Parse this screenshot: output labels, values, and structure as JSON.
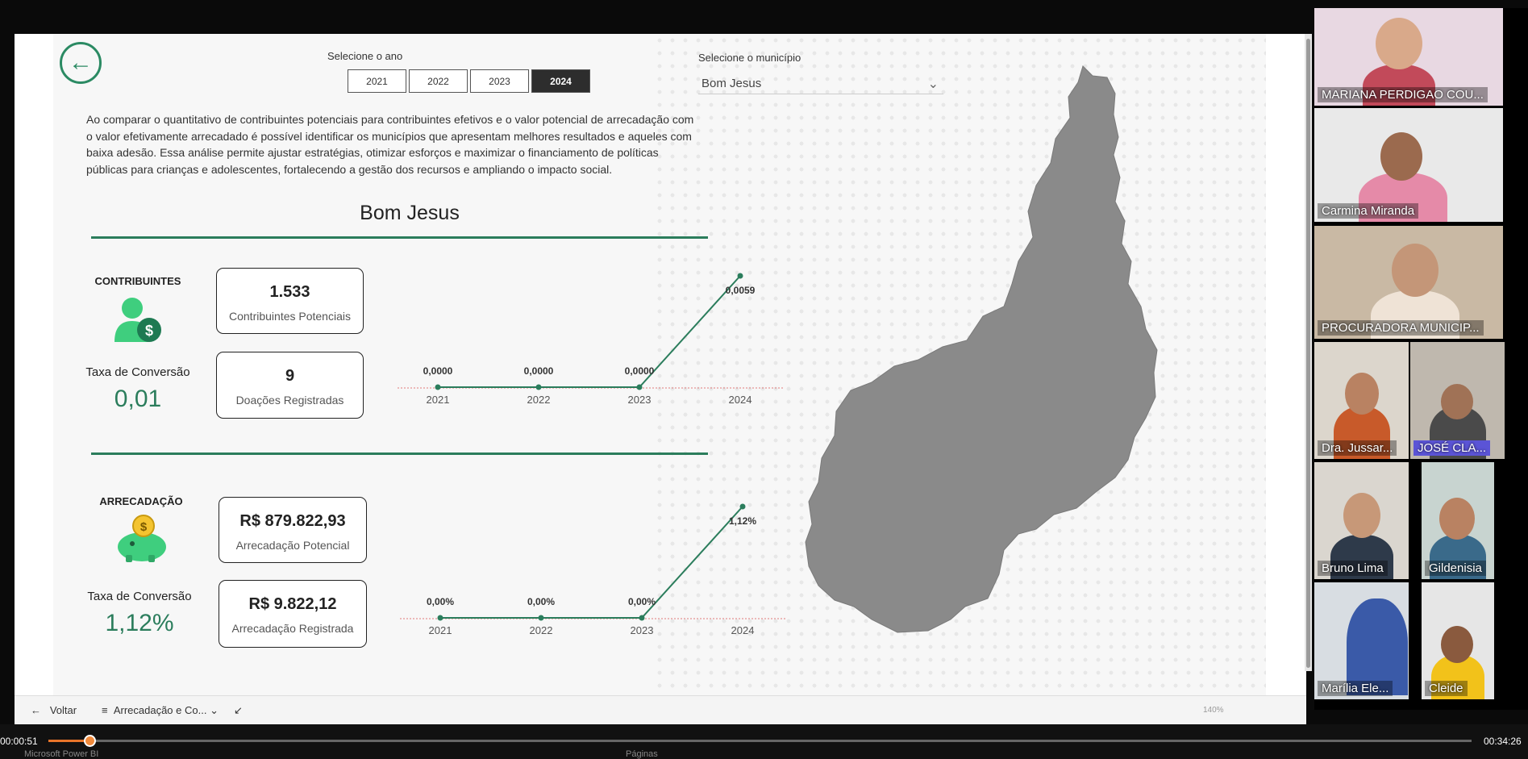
{
  "report": {
    "year_label": "Selecione o ano",
    "years": [
      "2021",
      "2022",
      "2023",
      "2024"
    ],
    "selected_year": "2024",
    "municipality_label": "Selecione o município",
    "municipality": "Bom Jesus",
    "description": "Ao comparar o quantitativo de contribuintes potenciais para contribuintes efetivos e o valor potencial de arrecadação com o valor efetivamente arrecadado é possível identificar os municípios que apresentam melhores resultados e aqueles com baixa adesão. Essa análise permite ajustar estratégias, otimizar esforços e maximizar o financiamento de políticas públicas para crianças e adolescentes, fortalecendo a gestão dos recursos e ampliando o impacto social.",
    "city_title": "Bom Jesus",
    "contrib": {
      "section_label": "CONTRIBUINTES",
      "conv_label": "Taxa de Conversão",
      "conv_value": "0,01",
      "kpi1_value": "1.533",
      "kpi1_label": "Contribuintes Potenciais",
      "kpi2_value": "9",
      "kpi2_label": "Doações Registradas"
    },
    "arrec": {
      "section_label": "ARRECADAÇÃO",
      "conv_label": "Taxa de Conversão",
      "conv_value": "1,12%",
      "kpi1_value": "R$ 879.822,93",
      "kpi1_label": "Arrecadação Potencial",
      "kpi2_value": "R$ 9.822,12",
      "kpi2_label": "Arrecadação Registrada"
    },
    "colors": {
      "accent": "#2b7d5c",
      "map": "#8a8a8a"
    }
  },
  "chart_data": [
    {
      "type": "line",
      "categories": [
        "2021",
        "2022",
        "2023",
        "2024"
      ],
      "values": [
        0.0,
        0.0,
        0.0,
        0.0059
      ],
      "data_labels": [
        "0,0000",
        "0,0000",
        "0,0000",
        "0,0059"
      ],
      "ylim": [
        0,
        0.0059
      ]
    },
    {
      "type": "line",
      "categories": [
        "2021",
        "2022",
        "2023",
        "2024"
      ],
      "values": [
        0.0,
        0.0,
        0.0,
        1.12
      ],
      "data_labels": [
        "0,00%",
        "0,00%",
        "0,00%",
        "1,12%"
      ],
      "ylim": [
        0,
        1.12
      ]
    }
  ],
  "participants": [
    {
      "name": "MARIANA PERDIGAO COU..."
    },
    {
      "name": "Carmina Miranda"
    },
    {
      "name": "PROCURADORA MUNICIP..."
    },
    {
      "name": "Dra. Jussar..."
    },
    {
      "name": "JOSÉ CLA..."
    },
    {
      "name": "Bruno Lima"
    },
    {
      "name": "Gildenisia"
    },
    {
      "name": "Marília Ele..."
    },
    {
      "name": "Cleide"
    }
  ],
  "bottombar": {
    "back_label": "Voltar",
    "page_label": "Arrecadação e Co..."
  },
  "player": {
    "elapsed": "00:00:51",
    "total": "00:34:26",
    "app_label": "Microsoft Power BI",
    "pages_label": "Páginas",
    "zoom": "140%"
  }
}
